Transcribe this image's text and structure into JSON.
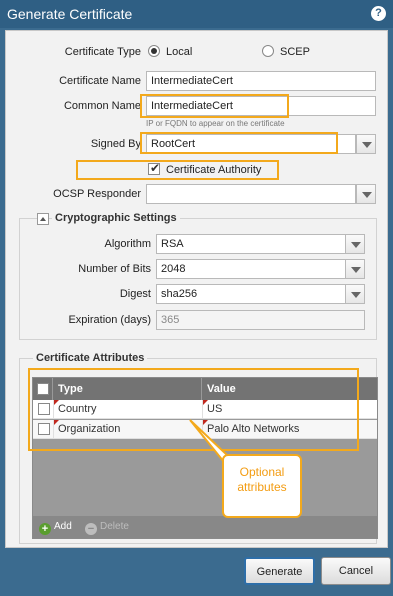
{
  "dialog": {
    "title": "Generate Certificate",
    "help_icon": "?"
  },
  "form": {
    "certificate_type_label": "Certificate Type",
    "type_options": [
      "Local",
      "SCEP"
    ],
    "type_selected": "Local",
    "certificate_name_label": "Certificate Name",
    "certificate_name_value": "IntermediateCert",
    "common_name_label": "Common Name",
    "common_name_value": "IntermediateCert",
    "common_name_hint": "IP or FQDN to appear on the certificate",
    "signed_by_label": "Signed By",
    "signed_by_value": "RootCert",
    "certificate_authority_label": "Certificate Authority",
    "certificate_authority_checked": true,
    "ocsp_label": "OCSP Responder",
    "ocsp_value": ""
  },
  "crypto": {
    "legend": "Cryptographic Settings",
    "algorithm_label": "Algorithm",
    "algorithm_value": "RSA",
    "bits_label": "Number of Bits",
    "bits_value": "2048",
    "digest_label": "Digest",
    "digest_value": "sha256",
    "expiration_label": "Expiration (days)",
    "expiration_value": "365"
  },
  "attributes": {
    "legend": "Certificate Attributes",
    "columns": [
      "Type",
      "Value"
    ],
    "rows": [
      {
        "type": "Country",
        "value": "US"
      },
      {
        "type": "Organization",
        "value": "Palo Alto Networks"
      }
    ],
    "add_label": "Add",
    "delete_label": "Delete"
  },
  "callout": {
    "line1": "Optional",
    "line2": "attributes"
  },
  "buttons": {
    "generate": "Generate",
    "cancel": "Cancel"
  },
  "colors": {
    "titlebar": "#2f5f84",
    "highlight": "#f3a91c",
    "callout_text": "#f39c12"
  }
}
